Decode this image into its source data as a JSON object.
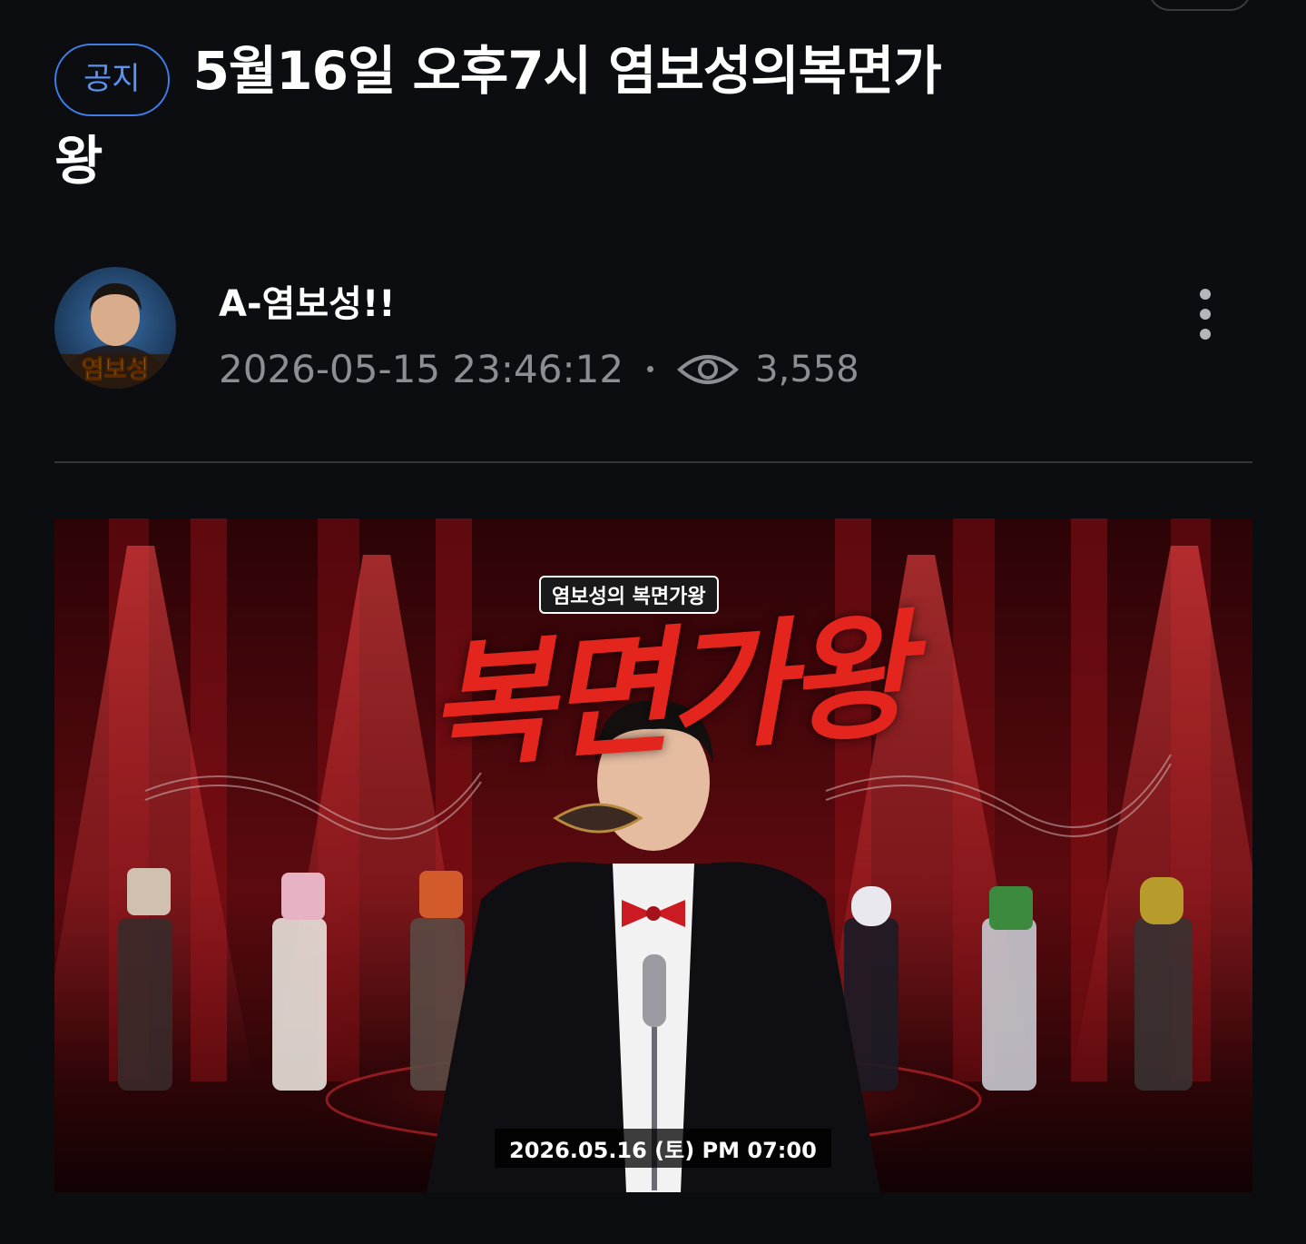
{
  "post": {
    "badge": "공지",
    "title_line1": "5월16일 오후7시 염보성의복면가",
    "title_line2": "왕"
  },
  "author": {
    "name": "A-염보성!!",
    "avatar_caption": "염보성",
    "datetime": "2026-05-15 23:46:12",
    "views": "3,558"
  },
  "banner": {
    "subtitle": "염보성의 복면가왕",
    "logo_text": "복면가왕",
    "date_text": "2026.05.16 (토) PM 07:00"
  },
  "icons": {
    "eye": "eye-icon",
    "more": "more-vertical-icon"
  },
  "colors": {
    "background": "#0c0d11",
    "badge_accent": "#3e7ee6",
    "meta_text": "#8d8e94",
    "logo_red": "#e3251e"
  }
}
